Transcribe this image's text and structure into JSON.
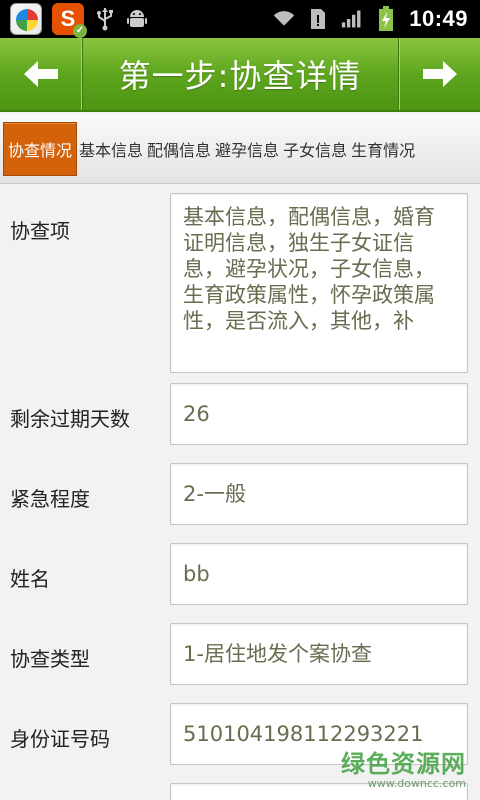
{
  "status_bar": {
    "time": "10:49",
    "app_icon_letter": "S",
    "icons": [
      "app-store-icon",
      "sogou-icon",
      "usb-icon",
      "android-debug-icon",
      "wifi-icon",
      "sim-icon",
      "signal-icon",
      "battery-charging-icon"
    ]
  },
  "header": {
    "title": "第一步:协查详情",
    "back_glyph": "←",
    "next_glyph": "→"
  },
  "tabs": [
    {
      "label": "协查情况",
      "active": true
    },
    {
      "label": "基本信息",
      "active": false
    },
    {
      "label": "配偶信息",
      "active": false
    },
    {
      "label": "避孕信息",
      "active": false
    },
    {
      "label": "子女信息",
      "active": false
    },
    {
      "label": "生育情况",
      "active": false
    }
  ],
  "form": {
    "rows": [
      {
        "label": "协查项",
        "value": "基本信息，配偶信息，婚育证明信息，独生子女证信息，避孕状况，子女信息，生育政策属性，怀孕政策属性，是否流入，其他，补"
      },
      {
        "label": "剩余过期天数",
        "value": "26"
      },
      {
        "label": "紧急程度",
        "value": "2-一般"
      },
      {
        "label": "姓名",
        "value": "bb"
      },
      {
        "label": "协查类型",
        "value": "1-居住地发个案协查"
      },
      {
        "label": "身份证号码",
        "value": "510104198112293221"
      }
    ]
  },
  "watermark": {
    "main": "绿色资源网",
    "sub": "www.downcc.com"
  },
  "colors": {
    "header_green": "#5ea61e",
    "active_tab": "#d4620a",
    "field_text": "#6b6b50"
  }
}
